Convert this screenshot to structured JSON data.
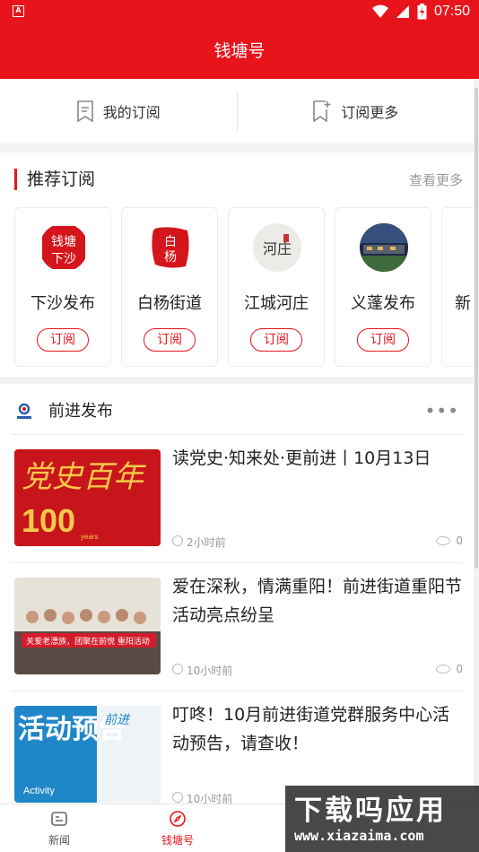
{
  "status_bar": {
    "time": "07:50",
    "app_glyph": "A"
  },
  "header": {
    "title": "钱塘号"
  },
  "subscription_bar": {
    "my_subscriptions": "我的订阅",
    "subscribe_more": "订阅更多"
  },
  "recommended": {
    "title": "推荐订阅",
    "view_more": "查看更多",
    "cards": [
      {
        "name": "下沙发布",
        "action": "订阅",
        "logo_text": "钱塘下沙"
      },
      {
        "name": "白杨街道",
        "action": "订阅",
        "logo_text": "白杨"
      },
      {
        "name": "江城河庄",
        "action": "订阅",
        "logo_text": "河庄"
      },
      {
        "name": "义蓬发布",
        "action": "订阅",
        "logo_text": ""
      },
      {
        "name": "新",
        "action": "",
        "logo_text": ""
      }
    ]
  },
  "feed": {
    "channel_name": "前进发布",
    "articles": [
      {
        "title": "读党史·知来处·更前进丨10月13日",
        "time": "2小时前",
        "views": "0",
        "thumb_text": "党史百年",
        "thumb_num": "100",
        "thumb_small": "years"
      },
      {
        "title": "爱在深秋，情满重阳！前进街道重阳节活动亮点纷呈",
        "time": "10小时前",
        "views": "0",
        "thumb_text": "关爱老漂族，团聚在前悦 重阳活动"
      },
      {
        "title": "叮咚！10月前进街道党群服务中心活动预告，请查收！",
        "time": "10小时前",
        "views": "",
        "thumb_text": "活动预告",
        "thumb_small": "Activity",
        "thumb_tag": "前进"
      }
    ]
  },
  "bottom_nav": {
    "news": "新闻",
    "qiantang": "钱塘号"
  },
  "watermark": {
    "line1": "下载吗应用",
    "line2": "www.xiazaima.com"
  },
  "colors": {
    "brand_red": "#e8141c",
    "muted": "#999999"
  }
}
